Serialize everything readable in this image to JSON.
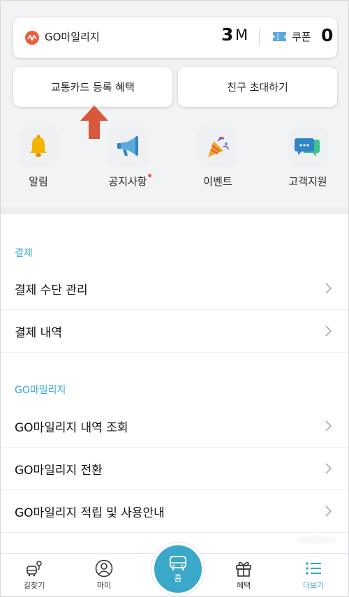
{
  "mileage": {
    "title": "GO마일리지",
    "value": "3",
    "unit": "M",
    "coupon_label": "쿠폰",
    "coupon_value": "0"
  },
  "actions": {
    "card_benefit": "교통카드 등록 혜택",
    "invite_friend": "친구 초대하기"
  },
  "quick_menu": [
    {
      "label": "알림",
      "icon": "bell-icon"
    },
    {
      "label": "공지사항",
      "icon": "megaphone-icon",
      "has_new": true
    },
    {
      "label": "이벤트",
      "icon": "party-popper-icon"
    },
    {
      "label": "고객지원",
      "icon": "chat-bubbles-icon"
    }
  ],
  "sections": [
    {
      "title": "결제",
      "items": [
        "결제 수단 관리",
        "결제 내역"
      ]
    },
    {
      "title": "GO마일리지",
      "items": [
        "GO마일리지 내역 조회",
        "GO마일리지 전환",
        "GO마일리지 적립 및 사용안내"
      ]
    }
  ],
  "bottom_nav": {
    "route": "길찾기",
    "my": "마이",
    "home": "홈",
    "benefit": "혜택",
    "more": "더보기",
    "active": "더보기"
  },
  "colors": {
    "accent": "#3aa8c9",
    "brand_red": "#ef5b3c",
    "arrow": "#d9573a"
  }
}
